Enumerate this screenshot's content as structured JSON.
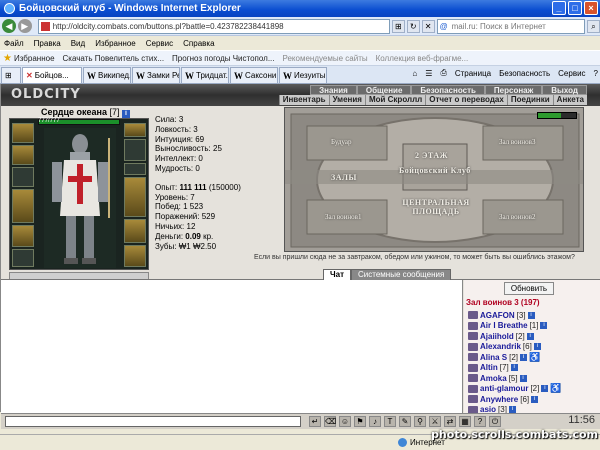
{
  "window": {
    "title": "Бойцовский клуб - Windows Internet Explorer"
  },
  "address": {
    "url": "http://oldcity.combats.com/buttons.pl?battle=0.423782238441898",
    "search_placeholder": "mail.ru: Поиск в Интернет"
  },
  "menu": [
    "Файл",
    "Правка",
    "Вид",
    "Избранное",
    "Сервис",
    "Справка"
  ],
  "favorites": {
    "label": "Избранное",
    "items": [
      "Скачать Повелитель стих...",
      "Прогноз погоды Чистопол...",
      "Рекомендуемые сайты",
      "Коллекция веб-фрагме..."
    ]
  },
  "tabs": [
    {
      "label": "Бойцов...",
      "active": true
    },
    {
      "label": "Википед..."
    },
    {
      "label": "Замки Ре..."
    },
    {
      "label": "Тридцат..."
    },
    {
      "label": "Саксони..."
    },
    {
      "label": "Иезуиты..."
    }
  ],
  "tab_tools": [
    "Страница",
    "Безопасность",
    "Сервис"
  ],
  "game": {
    "logo": "OLDCITY",
    "topnav": [
      "Знания",
      "Общение",
      "Безопасность",
      "Персонаж",
      "Выход"
    ],
    "subnav": [
      "Инвентарь",
      "Умения",
      "Мой Скроллл",
      "Отчет о переводах",
      "Поединки",
      "Анкета"
    ],
    "character": {
      "name": "Сердце океана",
      "level": "[7]",
      "hp": "777/777",
      "stats": [
        {
          "label": "Сила:",
          "value": "3"
        },
        {
          "label": "Ловкость:",
          "value": "3"
        },
        {
          "label": "Интуиция:",
          "value": "69"
        },
        {
          "label": "Выносливость:",
          "value": "25"
        },
        {
          "label": "Интеллект:",
          "value": "0"
        },
        {
          "label": "Мудрость:",
          "value": "0"
        }
      ],
      "experience": {
        "label": "Опыт:",
        "value": "111 111",
        "next": "(150000)"
      },
      "details": [
        {
          "label": "Уровень:",
          "value": "7"
        },
        {
          "label": "Побед:",
          "value": "1 523"
        },
        {
          "label": "Поражений:",
          "value": "529"
        },
        {
          "label": "Ничьих:",
          "value": "12"
        },
        {
          "label": "Деньги:",
          "value": "0.09",
          "unit": "кр."
        },
        {
          "label": "Зубы:",
          "value": "₩1 ₩2.50"
        }
      ]
    },
    "map": {
      "labels": {
        "buduar": "Будуар",
        "zal1": "Зал воинов1",
        "zal2": "Зал воинов2",
        "zal3": "Зал воинов3",
        "floor": "2 ЭТАЖ",
        "club": "Бойцовский Клуб",
        "halls": "ЗАЛЫ",
        "square": "ЦЕНТРАЛЬНАЯ ПЛОЩАДЬ",
        "zal_bottom": "Зал воинов3"
      },
      "note": "Если вы пришли сюда не за завтраком, обедом или ужином, то может быть вы ошиблись этажом?"
    },
    "chat": {
      "tabs": [
        "Чат",
        "Системные сообщения"
      ],
      "refresh_label": "Обновить",
      "room": "Зал воинов 3 (197)",
      "users": [
        {
          "name": "AGAFON",
          "level": "[3]"
        },
        {
          "name": "Air I Breathe",
          "level": "[1]"
        },
        {
          "name": "Ajaiihold",
          "level": "[2]"
        },
        {
          "name": "Alexandrik",
          "level": "[6]"
        },
        {
          "name": "Alina S",
          "level": "[2]",
          "mark": "♿"
        },
        {
          "name": "Altin",
          "level": "[7]"
        },
        {
          "name": "Amoka",
          "level": "[5]"
        },
        {
          "name": "anti-glamour",
          "level": "[2]",
          "mark": "♿"
        },
        {
          "name": "Anywhere",
          "level": "[6]"
        },
        {
          "name": "asio",
          "level": "[3]"
        }
      ]
    },
    "clock": "11:56"
  },
  "status": {
    "zone": "Интернет"
  },
  "watermark": "photo.scrolls.combats.com"
}
